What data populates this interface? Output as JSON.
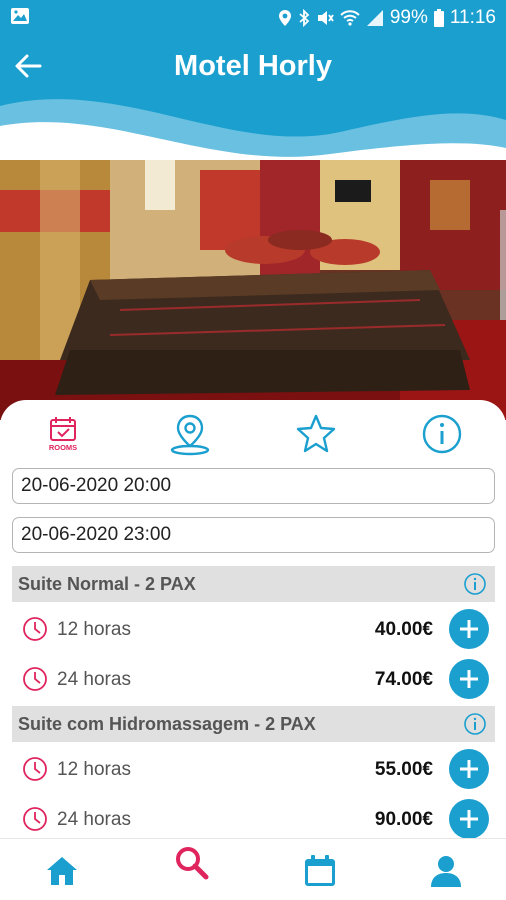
{
  "status_bar": {
    "battery": "99%",
    "time": "11:16"
  },
  "header": {
    "title": "Motel Horly"
  },
  "tabs": [
    {
      "icon": "calendar-rooms-icon",
      "label": "ROOMS",
      "active": true
    },
    {
      "icon": "location-pin-icon"
    },
    {
      "icon": "star-icon"
    },
    {
      "icon": "info-icon"
    }
  ],
  "booking": {
    "start": "20-06-2020 20:00",
    "end": "20-06-2020 23:00"
  },
  "rooms": [
    {
      "name": "Suite Normal - 2 PAX",
      "options": [
        {
          "duration": "12 horas",
          "price": "40.00€"
        },
        {
          "duration": "24 horas",
          "price": "74.00€"
        }
      ]
    },
    {
      "name": "Suite com Hidromassagem - 2 PAX",
      "options": [
        {
          "duration": "12 horas",
          "price": "55.00€"
        },
        {
          "duration": "24 horas",
          "price": "90.00€"
        }
      ]
    }
  ],
  "bottom_nav": [
    {
      "icon": "home-icon"
    },
    {
      "icon": "search-icon",
      "active": true
    },
    {
      "icon": "calendar-icon"
    },
    {
      "icon": "user-icon"
    }
  ],
  "colors": {
    "primary": "#1a9fcf",
    "accent": "#e0245e",
    "section_bg": "#e0e0e0"
  }
}
